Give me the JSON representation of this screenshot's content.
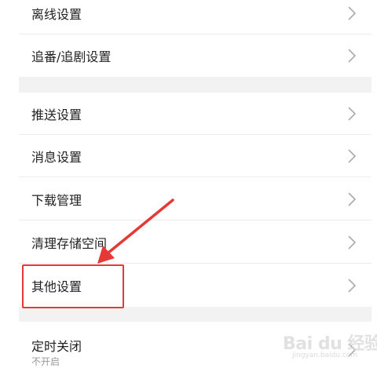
{
  "settings": {
    "items": [
      {
        "label": "离线设置"
      },
      {
        "label": "追番/追剧设置"
      },
      {
        "label": "推送设置"
      },
      {
        "label": "消息设置"
      },
      {
        "label": "下载管理"
      },
      {
        "label": "清理存储空间"
      },
      {
        "label": "其他设置"
      },
      {
        "label": "定时关闭",
        "sub": "不开启"
      }
    ]
  },
  "annotation": {
    "highlight_color": "#e53935",
    "target": "其他设置"
  },
  "watermark": {
    "brand": "Bai du 经验",
    "url": "jingyan.baidu.com"
  },
  "colors": {
    "background": "#ffffff",
    "section_gap": "#f2f2f2",
    "text": "#222222",
    "chevron": "#aaaaaa"
  }
}
